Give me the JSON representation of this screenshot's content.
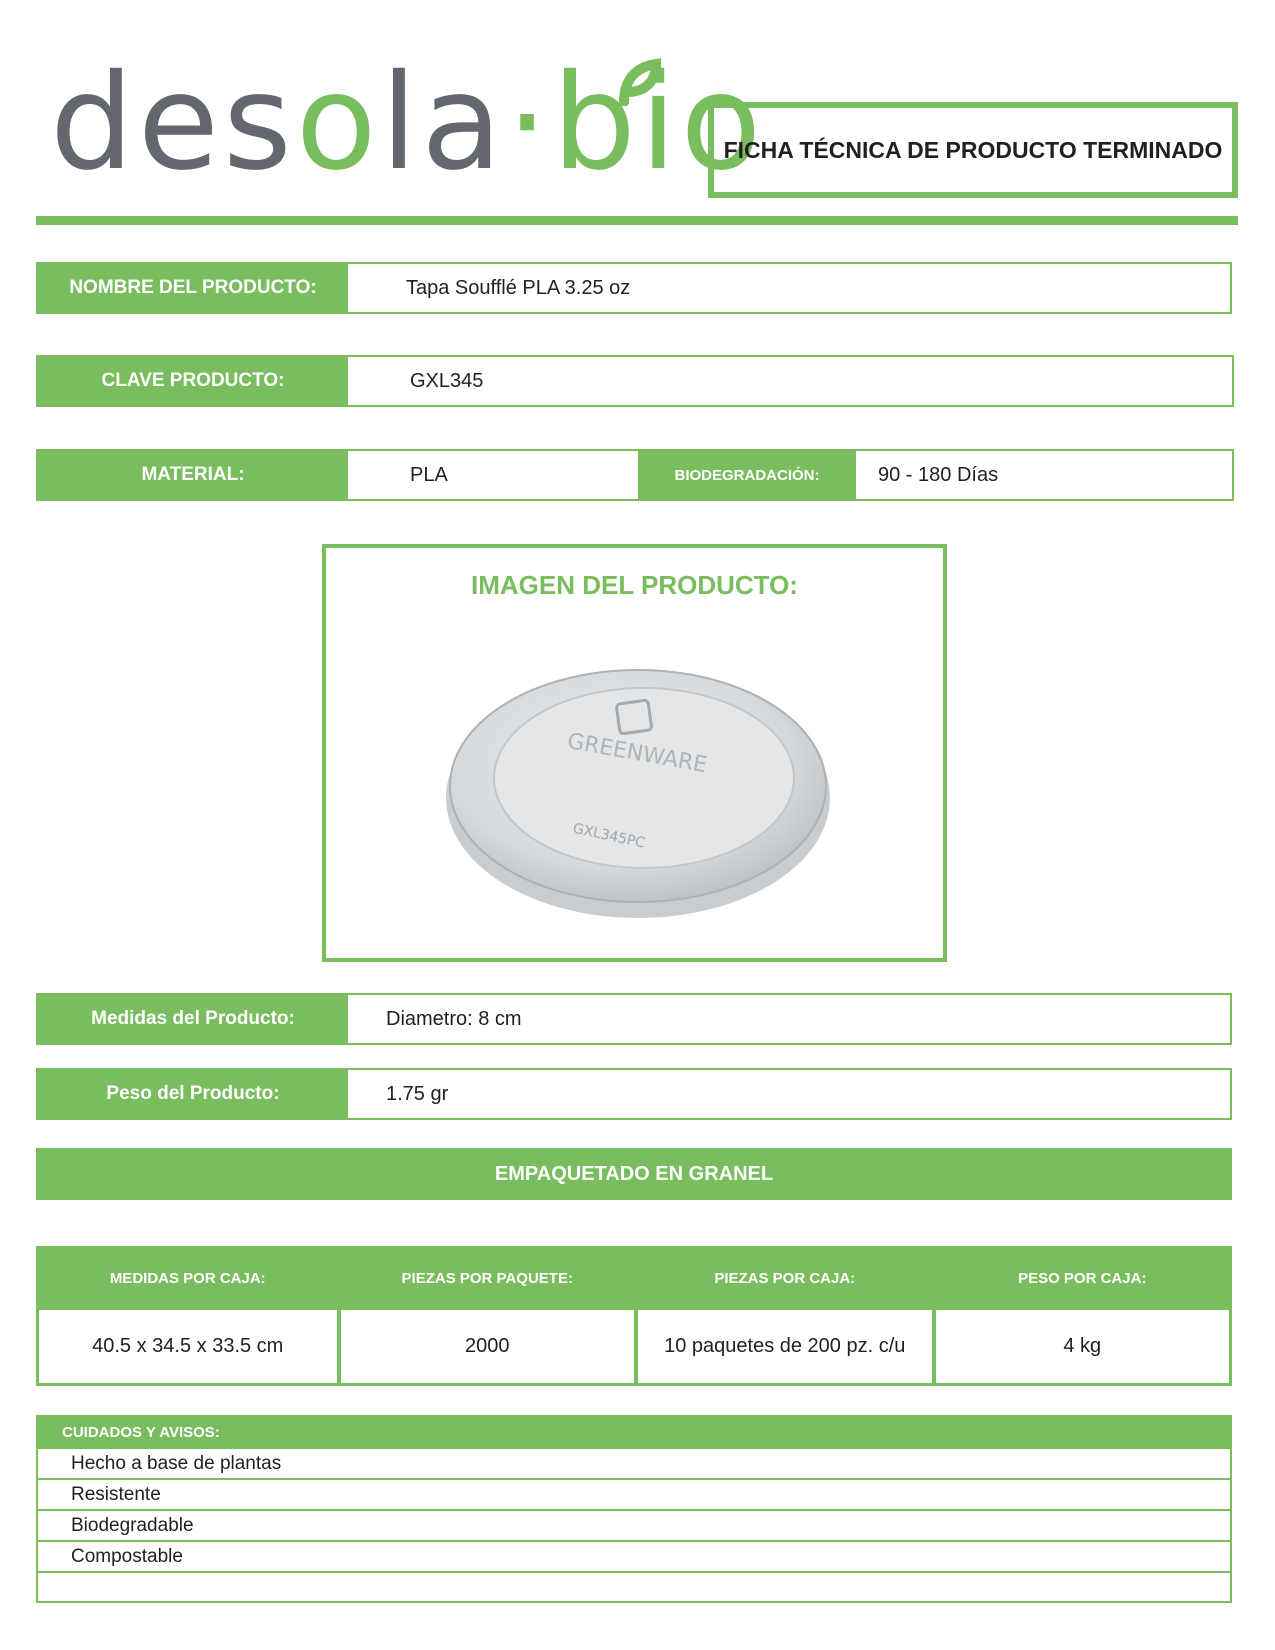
{
  "logo": {
    "part_grey": "des",
    "part_green1": "o",
    "part_grey2": "la",
    "part_green2": "·bio"
  },
  "header": {
    "title": "FICHA TÉCNICA DE PRODUCTO TERMINADO"
  },
  "product": {
    "name_label": "NOMBRE DEL PRODUCTO:",
    "name_value": "Tapa Soufflé PLA 3.25 oz",
    "code_label": "CLAVE PRODUCTO:",
    "code_value": "GXL345",
    "material_label": "MATERIAL:",
    "material_value": "PLA",
    "biodeg_label": "BIODEGRADACIÓN:",
    "biodeg_value": "90 - 180 Días"
  },
  "image_section": {
    "title": "IMAGEN DEL PRODUCTO:",
    "embossed_brand": "GREENWARE",
    "embossed_code": "GXL345PC"
  },
  "measures": {
    "size_label": "Medidas del Producto:",
    "size_value": "Diametro: 8 cm",
    "weight_label": "Peso del Producto:",
    "weight_value": "1.75 gr"
  },
  "packaging": {
    "banner": "EMPAQUETADO EN GRANEL",
    "headers": [
      "MEDIDAS POR CAJA:",
      "PIEZAS POR PAQUETE:",
      "PIEZAS POR CAJA:",
      "PESO POR CAJA:"
    ],
    "values": [
      "40.5 x 34.5 x 33.5 cm",
      "2000",
      "10 paquetes de 200 pz. c/u",
      "4 kg"
    ]
  },
  "notes": {
    "title": "CUIDADOS Y AVISOS:",
    "items": [
      "Hecho a base de plantas",
      "Resistente",
      "Biodegradable",
      "Compostable",
      ""
    ]
  },
  "colors": {
    "brand_green": "#79bd5f",
    "logo_grey": "#62686e",
    "text": "#231f20"
  }
}
